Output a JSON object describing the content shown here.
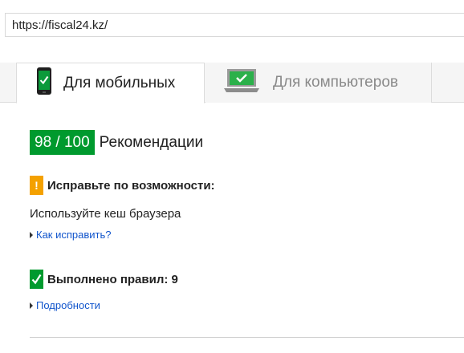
{
  "address_bar": {
    "url": "https://fiscal24.kz/"
  },
  "tabs": [
    {
      "label": "Для мобильных",
      "icon": "smartphone-icon",
      "active": true
    },
    {
      "label": "Для компьютеров",
      "icon": "laptop-icon",
      "active": false
    }
  ],
  "score": {
    "value": "98 / 100",
    "title": "Рекомендации",
    "color": "#009a2e"
  },
  "fix_section": {
    "icon": "exclamation-icon",
    "title": "Исправьте по возможности:",
    "item": "Используйте кеш браузера",
    "link": "Как исправить?",
    "color": "#f4a100"
  },
  "passed_section": {
    "icon": "checkmark-icon",
    "title": "Выполнено правил: 9",
    "link": "Подробности",
    "color": "#009a2e"
  }
}
